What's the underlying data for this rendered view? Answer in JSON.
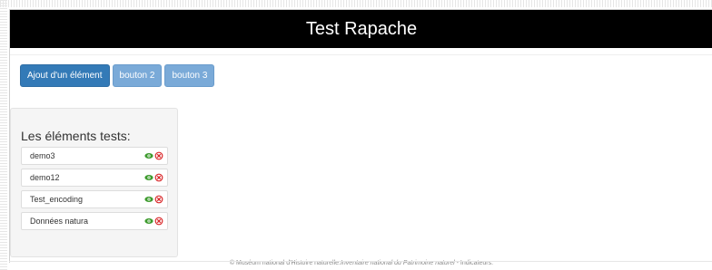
{
  "header": {
    "title": "Test Rapache"
  },
  "toolbar": {
    "buttons": [
      {
        "label": "Ajout d'un élément"
      },
      {
        "label": "bouton 2"
      },
      {
        "label": "bouton 3"
      }
    ]
  },
  "panel": {
    "title": "Les éléments tests:",
    "items": [
      {
        "label": "demo3",
        "view_icon": "eye-icon",
        "delete_icon": "remove-circle-icon"
      },
      {
        "label": "demo12",
        "view_icon": "eye-icon",
        "delete_icon": "remove-circle-icon"
      },
      {
        "label": "Test_encoding",
        "view_icon": "eye-icon",
        "delete_icon": "remove-circle-icon"
      },
      {
        "label": "Données natura",
        "view_icon": "eye-icon",
        "delete_icon": "remove-circle-icon"
      }
    ]
  },
  "footer": {
    "prefix": "© Muséum national d'Histoire naturelle.",
    "italic": "Inventaire national du Patrimoine naturel",
    "suffix": " - Indicateurs."
  },
  "colors": {
    "header_bg": "#000000",
    "primary": "#337ab7",
    "primary_light": "#7aaad8",
    "eye_green": "#3c9a2c",
    "remove_red": "#d9292b"
  }
}
